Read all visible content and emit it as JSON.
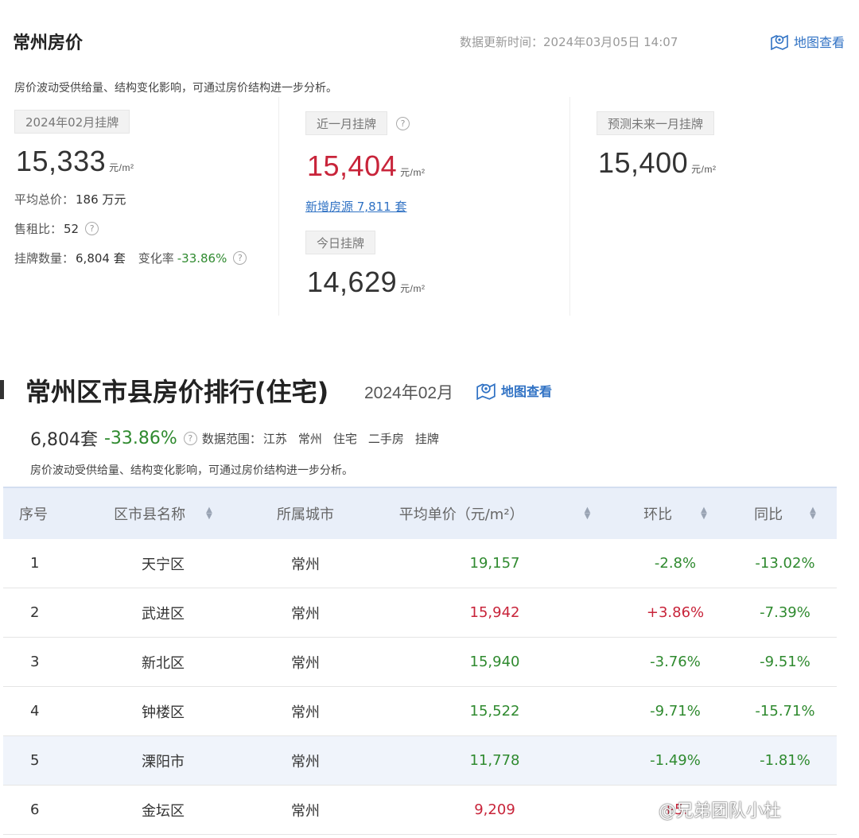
{
  "header": {
    "title": "常州房价",
    "update_label": "数据更新时间：",
    "update_time": "2024年03月05日 14:07",
    "map_label": "地图查看",
    "description": "房价波动受供给量、结构变化影响，可通过房价结构进一步分析。"
  },
  "col1": {
    "tag": "2024年02月挂牌",
    "price": "15,333",
    "unit": "元/m²",
    "avg_total_label": "平均总价：",
    "avg_total": "186 万元",
    "rent_ratio_label": "售租比：",
    "rent_ratio": "52",
    "listing_label": "挂牌数量：",
    "listing_count": "6,804 套",
    "change_label": "变化率",
    "change_rate": "-33.86%"
  },
  "col2": {
    "tag": "近一月挂牌",
    "price": "15,404",
    "unit": "元/m²",
    "new_source": "新增房源 7,811 套",
    "today_tag": "今日挂牌",
    "today_price": "14,629",
    "today_unit": "元/m²"
  },
  "col3": {
    "tag": "预测未来一月挂牌",
    "price": "15,400",
    "unit": "元/m²"
  },
  "ranking": {
    "title": "常州区市县房价排行(住宅)",
    "month": "2024年02月",
    "map_label": "地图查看",
    "count": "6,804套",
    "change": "-33.86%",
    "scope_label": "数据范围：",
    "scope": [
      "江苏",
      "常州",
      "住宅",
      "二手房",
      "挂牌"
    ],
    "description": "房价波动受供给量、结构变化影响，可通过房价结构进一步分析。"
  },
  "table": {
    "headers": [
      "序号",
      "区市县名称",
      "所属城市",
      "平均单价（元/m²）",
      "环比",
      "同比"
    ],
    "rows": [
      {
        "no": "1",
        "name": "天宁区",
        "city": "常州",
        "price": "19,157",
        "mom": "-2.8%",
        "yoy": "-13.02%"
      },
      {
        "no": "2",
        "name": "武进区",
        "city": "常州",
        "price": "15,942",
        "mom": "+3.86%",
        "yoy": "-7.39%"
      },
      {
        "no": "3",
        "name": "新北区",
        "city": "常州",
        "price": "15,940",
        "mom": "-3.76%",
        "yoy": "-9.51%"
      },
      {
        "no": "4",
        "name": "钟楼区",
        "city": "常州",
        "price": "15,522",
        "mom": "-9.71%",
        "yoy": "-15.71%"
      },
      {
        "no": "5",
        "name": "溧阳市",
        "city": "常州",
        "price": "11,778",
        "mom": "-1.49%",
        "yoy": "-1.81%"
      },
      {
        "no": "6",
        "name": "金坛区",
        "city": "常州",
        "price": "9,209",
        "mom": "+5.",
        "yoy": ""
      }
    ]
  },
  "watermark": "@兄弟团队小杜",
  "colors": {
    "accent_blue": "#3072c4",
    "up_red": "#c8243a",
    "down_green": "#2f8a2f",
    "header_bg": "#e9eff9"
  }
}
